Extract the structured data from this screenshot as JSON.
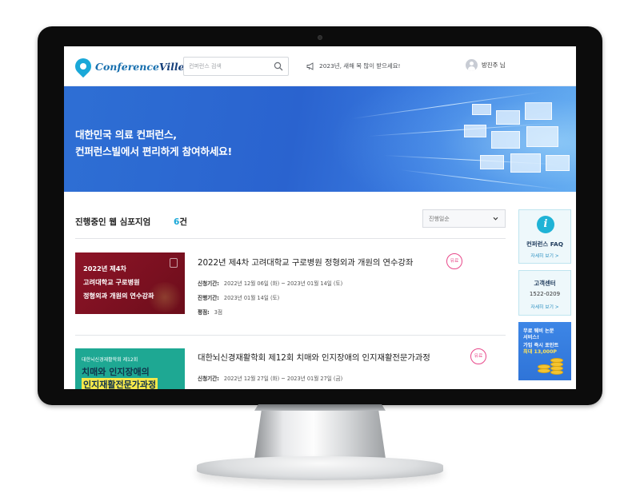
{
  "header": {
    "logo_part1": "Conference",
    "logo_part2": "Ville",
    "search_placeholder": "컨퍼런스 검색",
    "notice_text": "2023년, 새해 복 많이 받으세요!",
    "user_name": "방진주 님"
  },
  "banner": {
    "line1": "대한민국 의료 컨퍼런스,",
    "line2": "컨퍼런스빌에서 편리하게 참여하세요!"
  },
  "list": {
    "title": "진행중인 웹 심포지엄",
    "count": "6",
    "count_suffix": "건",
    "sort_selected": "진행일순"
  },
  "items": [
    {
      "thumb_lines": [
        "2022년 제4차",
        "고려대학교 구로병원",
        "정형외과 개원의 연수강좌"
      ],
      "title": "2022년 제4차 고려대학교 구로병원 정형외과 개원의 연수강좌",
      "badge": "유료",
      "meta": [
        {
          "label": "신청기간:",
          "value": "2022년 12월 06일 (화) ~ 2023년 01월 14일 (토)"
        },
        {
          "label": "진행기간:",
          "value": "2023년 01월 14일 (토)"
        },
        {
          "label": "평점:",
          "value": "3점"
        }
      ]
    },
    {
      "thumb_sub": "대한뇌신경재활학회 제12회",
      "thumb_lines": [
        "치매와 인지장애의",
        "인지재활전문가과정"
      ],
      "title": "대한뇌신경재활학회 제12회 치매와 인지장애의 인지재활전문가과정",
      "badge": "유료",
      "meta": [
        {
          "label": "신청기간:",
          "value": "2022년 12월 27일 (화) ~ 2023년 01월 27일 (금)"
        }
      ]
    }
  ],
  "sidebar": {
    "faq_title": "컨퍼런스 FAQ",
    "faq_link": "자세히 보기 >",
    "cs_title": "고객센터",
    "cs_phone": "1522-0209",
    "cs_link": "자세히 보기 >",
    "promo_lines": [
      "무료 웨비 논문",
      "서비스!",
      "가입 즉시 포인트",
      "최대 13,000P"
    ]
  },
  "colors": {
    "accent": "#1aa8d8",
    "banner": "#2e6fd4",
    "paid_badge": "#e8488a",
    "thumb1": "#8d1427",
    "thumb2": "#1ea893"
  },
  "icons": [
    "search-icon",
    "megaphone-icon",
    "avatar-icon",
    "chevron-down-icon",
    "info-icon",
    "coin-icon"
  ]
}
